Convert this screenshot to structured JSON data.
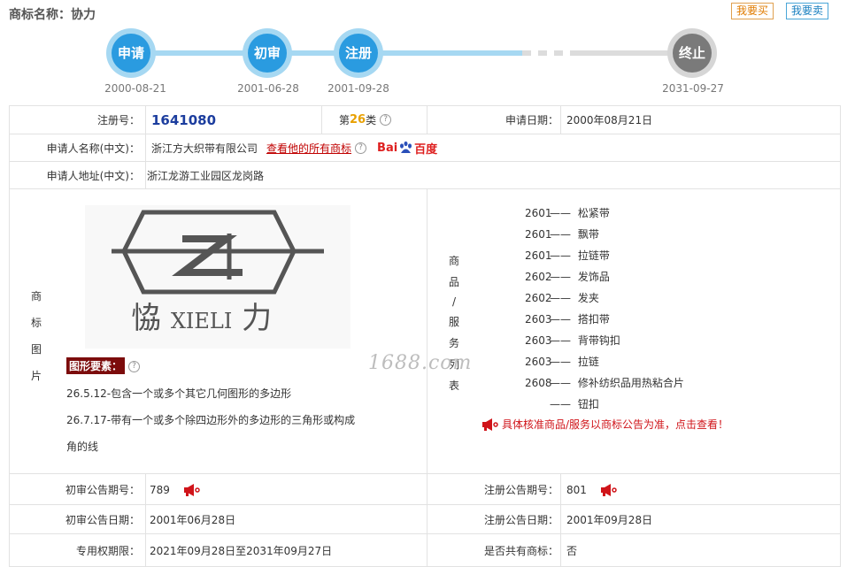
{
  "header": {
    "title": "商标名称：协力",
    "buy_label": "我要买",
    "sell_label": "我要卖"
  },
  "timeline": [
    {
      "label": "申请",
      "date": "2000-08-21",
      "state": "done"
    },
    {
      "label": "初审",
      "date": "2001-06-28",
      "state": "done"
    },
    {
      "label": "注册",
      "date": "2001-09-28",
      "state": "done"
    },
    {
      "label": "终止",
      "date": "2031-09-27",
      "state": "future"
    }
  ],
  "info": {
    "reg_no_label": "注册号：",
    "reg_no": "1641080",
    "class_prefix": "第",
    "class_num": "26",
    "class_suffix": "类",
    "apply_date_label": "申请日期：",
    "apply_date": "2000年08月21日",
    "applicant_label": "申请人名称(中文)：",
    "applicant": "浙江方大织带有限公司",
    "all_marks_link": "查看他的所有商标",
    "baidu_b1": "Bai",
    "baidu_b2": "du",
    "baidu_b3": "百度",
    "address_label": "申请人地址(中文)：",
    "address": "浙江龙游工业园区龙岗路"
  },
  "image_section": {
    "label_chars": [
      "商",
      "标",
      "图",
      "片"
    ],
    "logo_cn_left": "恊",
    "logo_text": "XIELI",
    "logo_cn_right": "力",
    "elements_tag": "图形要素：",
    "element_lines": [
      "26.5.12-包含一个或多个其它几何图形的多边形",
      "26.7.17-带有一个或多个除四边形外的多边形的三角形或构成",
      "角的线"
    ]
  },
  "goods_section": {
    "label_chars": [
      "商",
      "品",
      "/",
      "服",
      "务",
      "列",
      "表"
    ],
    "items": [
      {
        "code": "2601",
        "dash": "——",
        "name": "松紧带"
      },
      {
        "code": "2601",
        "dash": "——",
        "name": "飘带"
      },
      {
        "code": "2601",
        "dash": "——",
        "name": "拉链带"
      },
      {
        "code": "2602",
        "dash": "——",
        "name": "发饰品"
      },
      {
        "code": "2602",
        "dash": "——",
        "name": "发夹"
      },
      {
        "code": "2603",
        "dash": "——",
        "name": "搭扣带"
      },
      {
        "code": "2603",
        "dash": "——",
        "name": "背带钩扣"
      },
      {
        "code": "2603",
        "dash": "——",
        "name": "拉链"
      },
      {
        "code": "2608",
        "dash": "——",
        "name": "修补纺织品用热粘合片"
      },
      {
        "code": "",
        "dash": "——",
        "name": "钮扣"
      }
    ],
    "notice": "具体核准商品/服务以商标公告为准，点击查看！",
    "watermark": "1688.com"
  },
  "gazette": {
    "prelim_no_label": "初审公告期号：",
    "prelim_no": "789",
    "reg_no_label": "注册公告期号：",
    "reg_no": "801",
    "prelim_date_label": "初审公告日期：",
    "prelim_date": "2001年06月28日",
    "reg_date_label": "注册公告日期：",
    "reg_date": "2001年09月28日",
    "exclusive_label": "专用权期限：",
    "exclusive": "2021年09月28日至2031年09月27日",
    "shared_label": "是否共有商标：",
    "shared": "否"
  },
  "colors": {
    "accent_blue": "#2a9be0",
    "light_blue": "#a6d8f2",
    "end_gray": "#7a7a7a",
    "reg_no_blue": "#1c3d9e",
    "alert_red": "#d0141a"
  }
}
